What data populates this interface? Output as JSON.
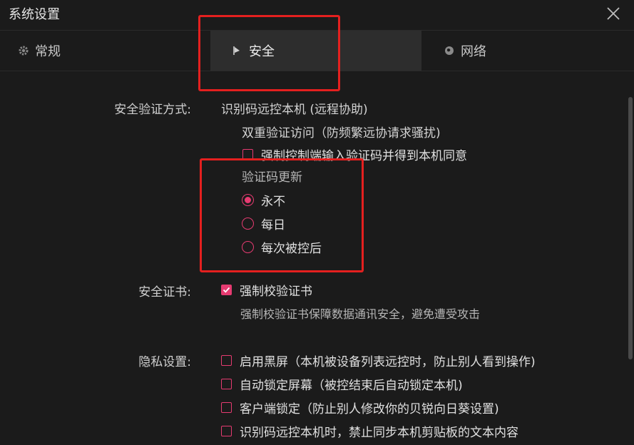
{
  "window": {
    "title": "系统设置"
  },
  "tabs": [
    {
      "label": "常规",
      "icon": "gear-icon"
    },
    {
      "label": "安全",
      "icon": "flag-icon",
      "selected": true
    },
    {
      "label": "网络",
      "icon": "globe-icon"
    }
  ],
  "auth": {
    "label": "安全验证方式:",
    "method": "识别码远控本机 (远程协助)",
    "double_verify": "双重验证访问（防频繁远协请求骚扰)",
    "force_code": {
      "label": "强制控制端输入验证码并得到本机同意",
      "checked": false
    },
    "refresh_title": "验证码更新",
    "refresh_options": [
      {
        "label": "永不",
        "selected": true
      },
      {
        "label": "每日",
        "selected": false
      },
      {
        "label": "每次被控后",
        "selected": false
      }
    ]
  },
  "cert": {
    "label": "安全证书:",
    "force_verify": {
      "label": "强制校验证书",
      "checked": true
    },
    "description": "强制校验证书保障数据通讯安全，避免遭受攻击"
  },
  "privacy": {
    "label": "隐私设置:",
    "options": [
      {
        "label": "启用黑屏（本机被设备列表远控时，防止别人看到操作)",
        "checked": false
      },
      {
        "label": "自动锁定屏幕（被控结束后自动锁定本机)",
        "checked": false
      },
      {
        "label": "客户端锁定（防止别人修改你的贝锐向日葵设置)",
        "checked": false
      },
      {
        "label": "识别码远控本机时，禁止同步本机剪贴板的文本内容",
        "checked": false
      }
    ]
  },
  "colors": {
    "accent": "#e63b71",
    "highlight": "#e4201f",
    "background": "#1b1b1b",
    "tab_selected": "#2d2d2d"
  }
}
